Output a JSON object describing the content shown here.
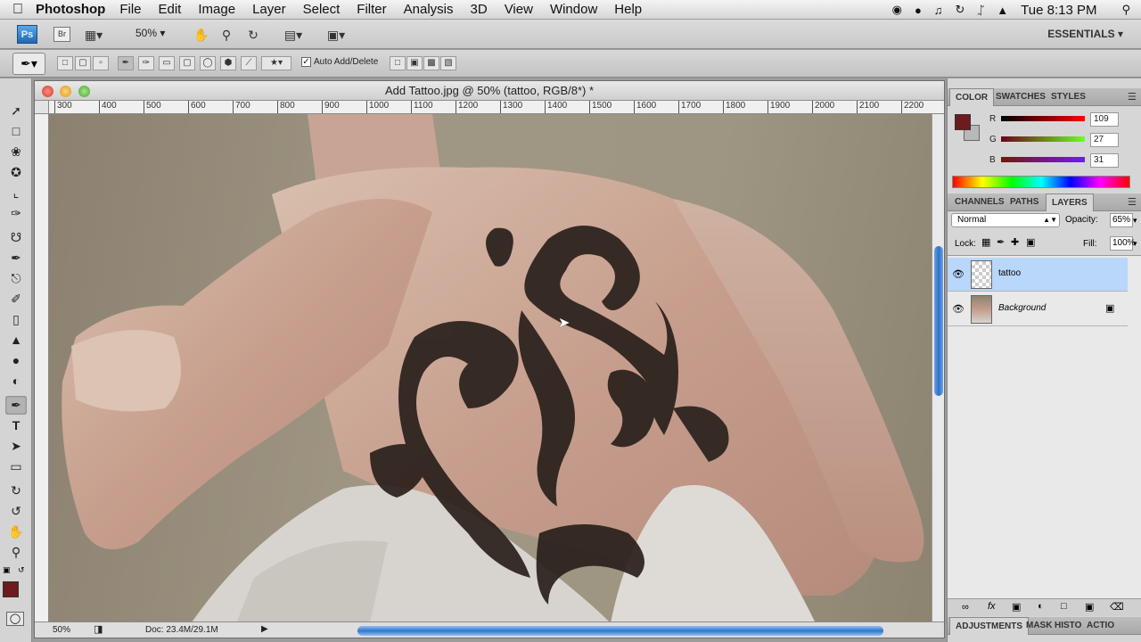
{
  "menubar": {
    "app_name": "Photoshop",
    "items": [
      "File",
      "Edit",
      "Image",
      "Layer",
      "Select",
      "Filter",
      "Analysis",
      "3D",
      "View",
      "Window",
      "Help"
    ],
    "clock": "Tue 8:13 PM"
  },
  "appbar": {
    "logo": "Ps",
    "bridge": "Br",
    "zoom_value": "50%",
    "workspace": "ESSENTIALS"
  },
  "options": {
    "auto_add_delete_label": "Auto Add/Delete",
    "auto_add_delete_checked": true
  },
  "document": {
    "title": "Add Tattoo.jpg @ 50% (tattoo, RGB/8*) *",
    "ruler_ticks": [
      "300",
      "400",
      "500",
      "600",
      "700",
      "800",
      "900",
      "1000",
      "1100",
      "1200",
      "1300",
      "1400",
      "1500",
      "1600",
      "1700",
      "1800",
      "1900",
      "2000",
      "2100",
      "2200"
    ],
    "status_zoom": "50%",
    "doc_size": "Doc: 23.4M/29.1M"
  },
  "color_panel": {
    "tabs": [
      "COLOR",
      "SWATCHES",
      "STYLES"
    ],
    "r_label": "R",
    "r_value": "109",
    "g_label": "G",
    "g_value": "27",
    "b_label": "B",
    "b_value": "31",
    "foreground": "#6d1b1f"
  },
  "layers_panel": {
    "tabs": [
      "CHANNELS",
      "PATHS",
      "LAYERS"
    ],
    "blend_mode": "Normal",
    "opacity_label": "Opacity:",
    "opacity_value": "65%",
    "lock_label": "Lock:",
    "fill_label": "Fill:",
    "fill_value": "100%",
    "layers": [
      {
        "name": "tattoo",
        "selected": true
      },
      {
        "name": "Background",
        "selected": false
      }
    ]
  },
  "bottom_panel": {
    "tabs": [
      "ADJUSTMENTS",
      "MASK",
      "HISTO",
      "ACTIO"
    ]
  }
}
